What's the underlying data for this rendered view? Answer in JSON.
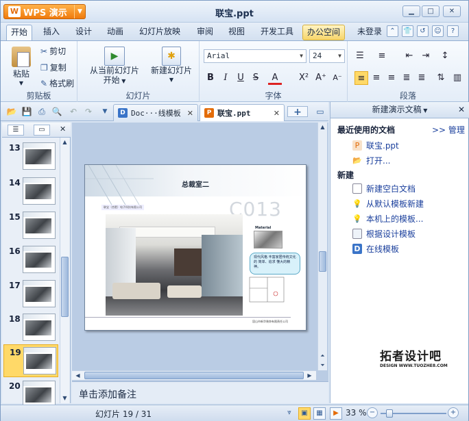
{
  "window": {
    "app_button": "WPS 演示",
    "title": "联宝.ppt"
  },
  "menu": {
    "tabs": [
      "开始",
      "插入",
      "设计",
      "动画",
      "幻灯片放映",
      "审阅",
      "视图",
      "开发工具",
      "办公空间"
    ],
    "login": "未登录"
  },
  "ribbon": {
    "clipboard": {
      "paste": "粘贴",
      "cut": "剪切",
      "copy": "复制",
      "format_painter": "格式刷",
      "group": "剪贴板"
    },
    "slides": {
      "from_current_line1": "从当前幻灯片",
      "from_current_line2": "开始",
      "new_slide": "新建幻灯片",
      "group": "幻灯片"
    },
    "font": {
      "font_name": "Arial",
      "font_size": "24",
      "group": "字体",
      "bold": "B",
      "italic": "I",
      "underline": "U",
      "strike": "S",
      "color": "A",
      "superscript": "X²",
      "grow": "A⁺",
      "shrink": "A⁻"
    },
    "paragraph": {
      "group": "段落"
    }
  },
  "doc_tabs": [
    {
      "label": "Doc···线模板",
      "active": false
    },
    {
      "label": "联宝.ppt",
      "active": true
    }
  ],
  "slides_panel": {
    "numbers": [
      "13",
      "14",
      "15",
      "16",
      "17",
      "18",
      "19",
      "20"
    ],
    "selected": "19"
  },
  "slide": {
    "title": "总裁室二",
    "code": "C013",
    "company_tag": "联宝（合肥）电子科技有限公司",
    "material_label": "Material",
    "callout": "现代风格 丰富家居传统文化的 简单、追求 懂大的精神。",
    "footer": "昆山市新华装饰有限责任公司"
  },
  "notes_placeholder": "单击添加备注",
  "task_pane": {
    "title": "新建演示文稿",
    "recent_heading": "最近使用的文档",
    "manage": ">> 管理",
    "recent": [
      "联宝.ppt",
      "打开..."
    ],
    "new_heading": "新建",
    "new_items": [
      "新建空白文档",
      "从默认模板新建",
      "本机上的模板...",
      "根据设计模板",
      "在线模板"
    ]
  },
  "status": {
    "slide_info": "幻灯片 19 / 31",
    "zoom": "33 %"
  },
  "watermark": {
    "main": "拓者设计吧",
    "sub": "DESIGN WWW.TUOZHE8.COM"
  },
  "colors": {
    "accent": "#f07a0c",
    "link": "#1a3f9c",
    "selected_thumb": "#ffd968"
  }
}
